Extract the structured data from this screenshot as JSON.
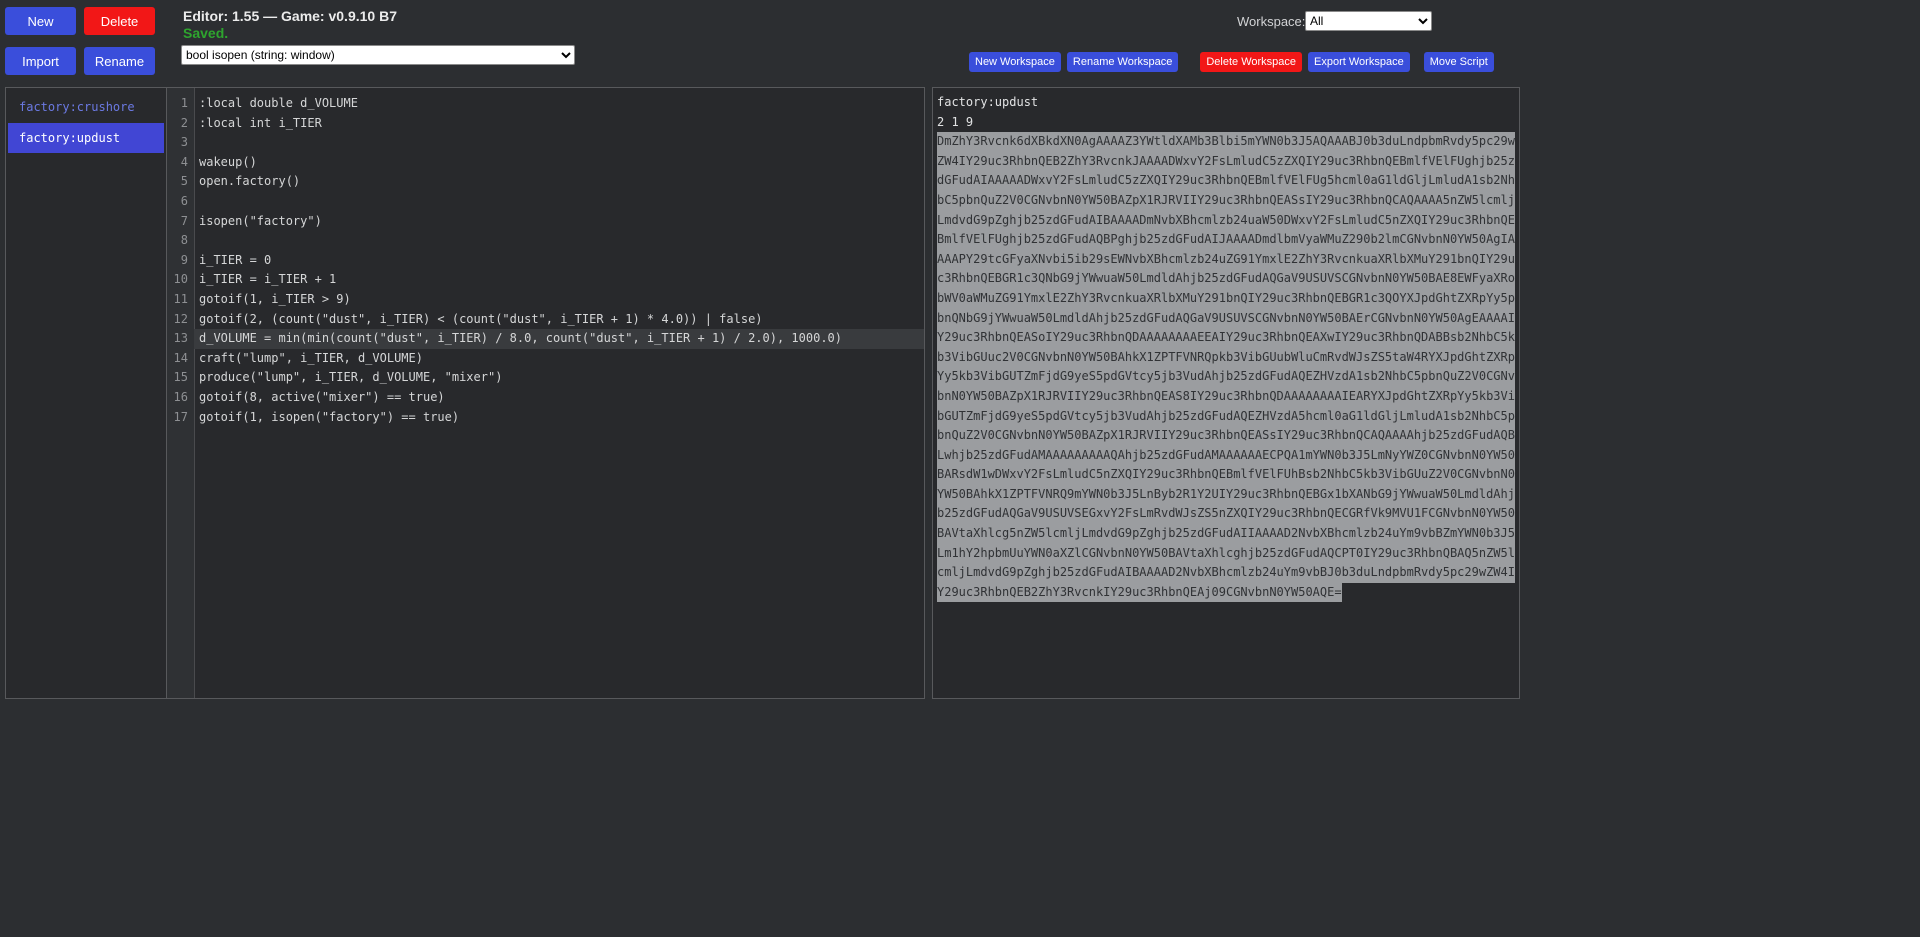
{
  "header": {
    "title": "Editor: 1.55 — Game: v0.9.10 B7",
    "status": "Saved.",
    "new_label": "New",
    "delete_label": "Delete",
    "import_label": "Import",
    "rename_label": "Rename",
    "function_dropdown_value": "bool isopen (string: window)",
    "workspace_label": "Workspace:",
    "workspace_selected": "All",
    "workspace_buttons": [
      {
        "label": "New Workspace",
        "danger": false
      },
      {
        "label": "Rename Workspace",
        "danger": false
      },
      {
        "label": "Delete Workspace",
        "danger": true
      },
      {
        "label": "Export Workspace",
        "danger": false
      },
      {
        "label": "Move Script",
        "danger": false
      }
    ]
  },
  "sidebar": {
    "scripts": [
      {
        "name": "factory:crushore",
        "selected": false
      },
      {
        "name": "factory:updust",
        "selected": true
      }
    ]
  },
  "editor": {
    "active_line": 13,
    "lines": [
      ":local double d_VOLUME",
      ":local int i_TIER",
      "",
      "wakeup()",
      "open.factory()",
      "",
      "isopen(\"factory\")",
      "",
      "i_TIER = 0",
      "i_TIER = i_TIER + 1",
      "gotoif(1, i_TIER > 9)",
      "gotoif(2, (count(\"dust\", i_TIER) < (count(\"dust\", i_TIER + 1) * 4.0)) | false)",
      "d_VOLUME = min(min(count(\"dust\", i_TIER) / 8.0, count(\"dust\", i_TIER + 1) / 2.0), 1000.0)",
      "craft(\"lump\", i_TIER, d_VOLUME)",
      "produce(\"lump\", i_TIER, d_VOLUME, \"mixer\")",
      "gotoif(8, active(\"mixer\") == true)",
      "gotoif(1, isopen(\"factory\") == true)"
    ]
  },
  "export_panel": {
    "script_name": "factory:updust",
    "counts": "2 1 9",
    "base64_lines": [
      "DmZhY3Rvcnk6dXBkdXN0AgAAAAZ3YWtldXAMb3Blbi5mYWN0b3J5AQAAABJ0b3duLndpbmRvdy5pc29w",
      "ZW4IY29uc3RhbnQEB2ZhY3RvcnkJAAAADWxvY2FsLmludC5zZXQIY29uc3RhbnQEBmlfVElFUghjb25z",
      "dGFudAIAAAAADWxvY2FsLmludC5zZXQIY29uc3RhbnQEBmlfVElFUg5hcml0aG1ldGljLmludA1sb2Nh",
      "bC5pbnQuZ2V0CGNvbnN0YW50BAZpX1RJRVIIY29uc3RhbnQEASsIY29uc3RhbnQCAQAAAA5nZW5lcmlj",
      "LmdvdG9pZghjb25zdGFudAIBAAAADmNvbXBhcmlzb24uaW50DWxvY2FsLmludC5nZXQIY29uc3RhbnQE",
      "BmlfVElFUghjb25zdGFudAQBPghjb25zdGFudAIJAAAADmdlbmVyaWMuZ290b2lmCGNvbnN0YW50AgIA",
      "AAAPY29tcGFyaXNvbi5ib29sEWNvbXBhcmlzb24uZG91YmxlE2ZhY3RvcnkuaXRlbXMuY291bnQIY29u",
      "c3RhbnQEBGR1c3QNbG9jYWwuaW50LmdldAhjb25zdGFudAQGaV9USUVSCGNvbnN0YW50BAE8EWFyaXRo",
      "bWV0aWMuZG91YmxlE2ZhY3RvcnkuaXRlbXMuY291bnQIY29uc3RhbnQEBGR1c3QOYXJpdGhtZXRpYy5p",
      "bnQNbG9jYWwuaW50LmdldAhjb25zdGFudAQGaV9USUVSCGNvbnN0YW50BAErCGNvbnN0YW50AgEAAAAI",
      "Y29uc3RhbnQEASoIY29uc3RhbnQDAAAAAAAAEEAIY29uc3RhbnQEAXwIY29uc3RhbnQDABBsb2NhbC5k",
      "b3VibGUuc2V0CGNvbnN0YW50BAhkX1ZPTFVNRQpkb3VibGUubWluCmRvdWJsZS5taW4RYXJpdGhtZXRp",
      "Yy5kb3VibGUTZmFjdG9yeS5pdGVtcy5jb3VudAhjb25zdGFudAQEZHVzdA1sb2NhbC5pbnQuZ2V0CGNv",
      "bnN0YW50BAZpX1RJRVIIY29uc3RhbnQEAS8IY29uc3RhbnQDAAAAAAAAIEARYXJpdGhtZXRpYy5kb3Vi",
      "bGUTZmFjdG9yeS5pdGVtcy5jb3VudAhjb25zdGFudAQEZHVzdA5hcml0aG1ldGljLmludA1sb2NhbC5p",
      "bnQuZ2V0CGNvbnN0YW50BAZpX1RJRVIIY29uc3RhbnQEASsIY29uc3RhbnQCAQAAAAhjb25zdGFudAQB",
      "Lwhjb25zdGFudAMAAAAAAAAAQAhjb25zdGFudAMAAAAAAECPQA1mYWN0b3J5LmNyYWZ0CGNvbnN0YW50",
      "BARsdW1wDWxvY2FsLmludC5nZXQIY29uc3RhbnQEBmlfVElFUhBsb2NhbC5kb3VibGUuZ2V0CGNvbnN0",
      "YW50BAhkX1ZPTFVNRQ9mYWN0b3J5LnByb2R1Y2UIY29uc3RhbnQEBGx1bXANbG9jYWwuaW50LmdldAhj",
      "b25zdGFudAQGaV9USUVSEGxvY2FsLmRvdWJsZS5nZXQIY29uc3RhbnQECGRfVk9MVU1FCGNvbnN0YW50",
      "BAVtaXhlcg5nZW5lcmljLmdvdG9pZghjb25zdGFudAIIAAAAD2NvbXBhcmlzb24uYm9vbBZmYWN0b3J5",
      "Lm1hY2hpbmUuYWN0aXZlCGNvbnN0YW50BAVtaXhlcghjb25zdGFudAQCPT0IY29uc3RhbnQBAQ5nZW5l",
      "cmljLmdvdG9pZghjb25zdGFudAIBAAAAD2NvbXBhcmlzb24uYm9vbBJ0b3duLndpbmRvdy5pc29wZW4I",
      "Y29uc3RhbnQEB2ZhY3RvcnkIY29uc3RhbnQEAj09CGNvbnN0YW50AQE="
    ]
  },
  "colors": {
    "accent_blue": "#3a4edb",
    "danger_red": "#f21717",
    "saved_green": "#2ea52e",
    "selected_script_blue": "#4146d4",
    "script_name_blue": "#6b79e2",
    "selection_gray": "#9b9da0",
    "background": "#2c2e31"
  }
}
